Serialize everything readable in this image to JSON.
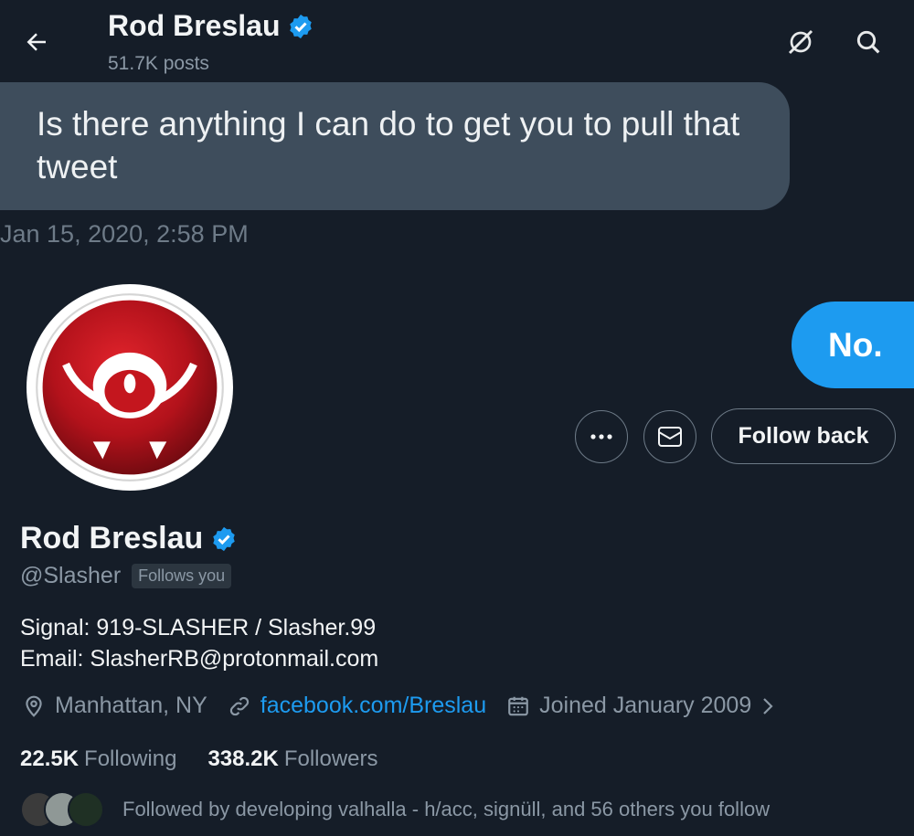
{
  "header": {
    "title": "Rod Breslau",
    "posts_count": "51.7K posts"
  },
  "dm": {
    "incoming_text": "Is there anything I can do to get you to pull that tweet",
    "timestamp": "Jan 15, 2020, 2:58 PM",
    "outgoing_text": "No."
  },
  "profile": {
    "name": "Rod Breslau",
    "handle": "@Slasher",
    "follows_you": "Follows you",
    "bio_line1": "Signal: 919-SLASHER / Slasher.99",
    "bio_line2": "Email: SlasherRB@protonmail.com",
    "location": "Manhattan, NY",
    "website": "facebook.com/Breslau",
    "joined": "Joined January 2009",
    "following_count": "22.5K",
    "following_label": "Following",
    "followers_count": "338.2K",
    "followers_label": "Followers",
    "followed_by": "Followed by developing valhalla - h/acc, signüll, and 56 others you follow"
  },
  "actions": {
    "follow_back": "Follow back"
  },
  "colors": {
    "background": "#151d28",
    "accent": "#1d9bf0",
    "incoming_bubble": "#3e4d5c",
    "muted_text": "#8b98a5",
    "avatar_red": "#b3121b"
  },
  "icons": [
    "back-arrow-icon",
    "verified-badge-icon",
    "grok-icon",
    "search-icon",
    "more-icon",
    "mail-icon",
    "location-icon",
    "link-icon",
    "calendar-icon",
    "chevron-right-icon"
  ]
}
